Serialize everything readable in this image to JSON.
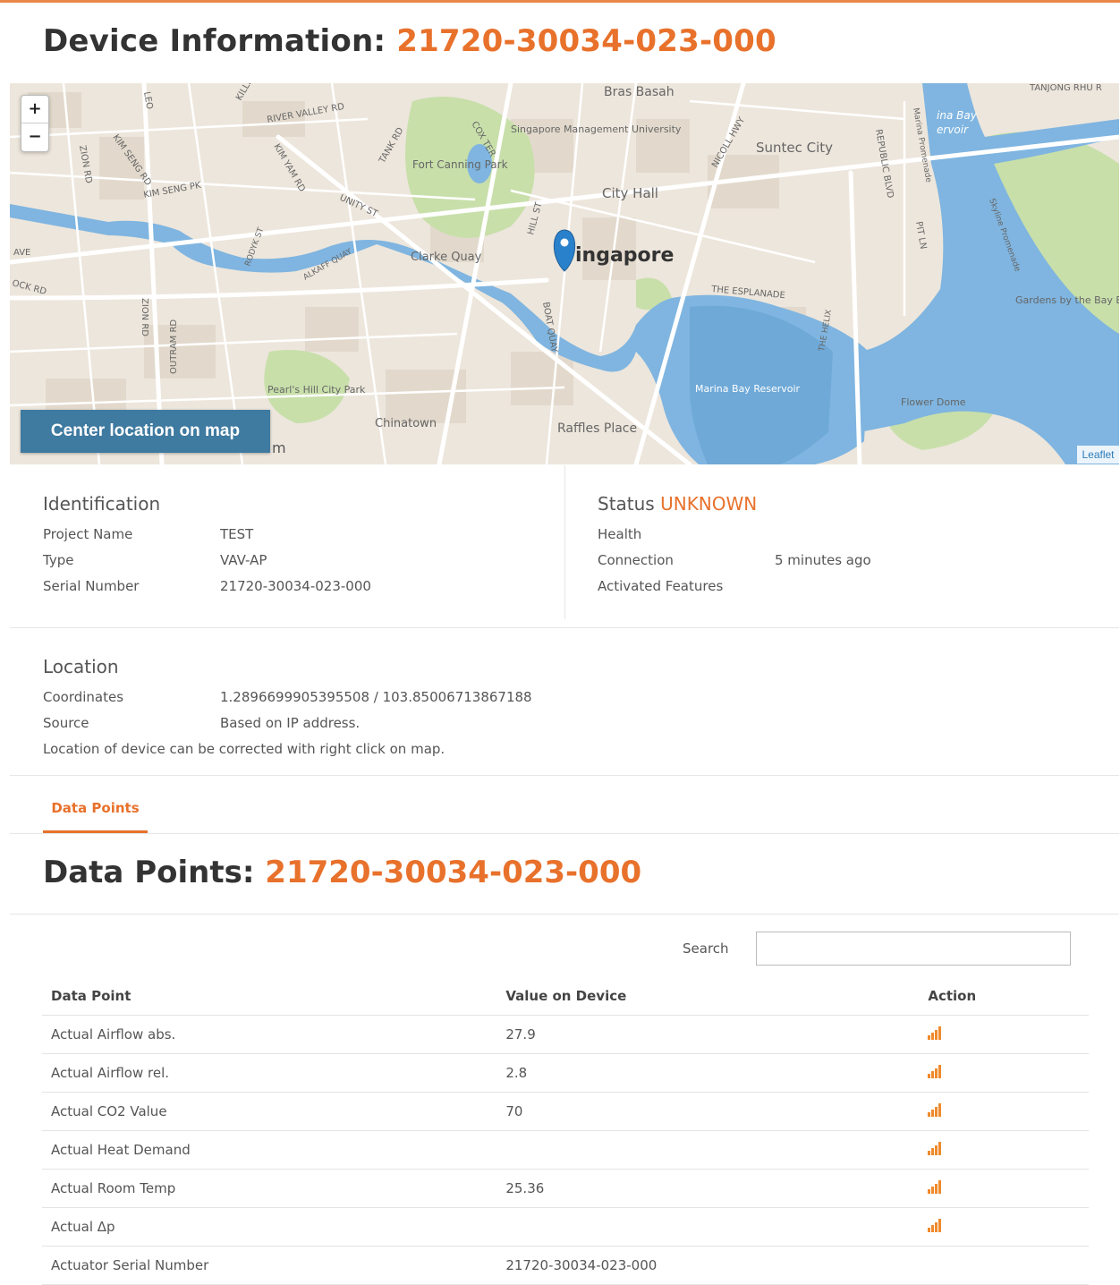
{
  "page": {
    "title_prefix": "Device Information:",
    "device_id": "21720-30034-023-000"
  },
  "map": {
    "zoom_in": "+",
    "zoom_out": "−",
    "center_button": "Center location on map",
    "attribution": "Leaflet",
    "labels": {
      "bras_basah": "Bras Basah",
      "tanjong": "TANJONG RHU R",
      "river_valley": "RIVER VALLEY RD",
      "kim_seng_rd": "KIM SENG RD",
      "kim_seng_pk": "KIM SENG PK",
      "zion_rd": "ZION RD",
      "zion_rd2": "ZION RD",
      "outram": "OUTRAM RD",
      "smu": "Singapore Management University",
      "fort_canning": "Fort Canning Park",
      "suntec": "Suntec City",
      "city_hall": "City Hall",
      "singapore": "ingapore",
      "clarke_quay": "Clarke Quay",
      "esplanade": "THE ESPLANADE",
      "marina_bay": "Marina Bay Reservoir",
      "gardens": "Gardens by the Bay East",
      "flower_dome": "Flower Dome",
      "raffles": "Raffles Place",
      "chinatown": "Chinatown",
      "pearls_hill": "Pearl's Hill City Park",
      "republic": "REPUBLIC BLVD",
      "nicoll": "NICOLL HWY",
      "marina_promenade": "Marina Promenade",
      "pit_ln": "PIT LN",
      "hill_st": "HILL ST",
      "boat_quay": "BOAT QUAY",
      "tank_rd": "TANK RD",
      "unity_st": "UNITY ST",
      "alkaff": "ALKAFF QUAY",
      "kim_yam": "KIM YAM RD",
      "rodyk": "RODYK ST",
      "ave": "AVE",
      "ock_rd": "OCK RD",
      "the_helix": "THE HELIX",
      "skyline": "Skyline Promenade",
      "rina_bay": "ina Bay",
      "ervoir": "ervoir",
      "leo": "LEO",
      "killiney": "KILLI",
      "m_frag": "m",
      "cox_ter": "COX TER"
    }
  },
  "identification": {
    "heading": "Identification",
    "rows": [
      {
        "label": "Project Name",
        "value": "TEST"
      },
      {
        "label": "Type",
        "value": "VAV-AP"
      },
      {
        "label": "Serial Number",
        "value": "21720-30034-023-000"
      }
    ]
  },
  "status": {
    "heading": "Status",
    "state": "UNKNOWN",
    "rows": [
      {
        "label": "Health",
        "value": ""
      },
      {
        "label": "Connection",
        "value": "5 minutes ago"
      },
      {
        "label": "Activated Features",
        "value": ""
      }
    ]
  },
  "location": {
    "heading": "Location",
    "rows": [
      {
        "label": "Coordinates",
        "value": "1.2896699905395508 / 103.85006713867188"
      },
      {
        "label": "Source",
        "value": "Based on IP address."
      }
    ],
    "note": "Location of device can be corrected with right click on map."
  },
  "tabs": [
    {
      "label": "Data Points",
      "active": true
    }
  ],
  "data_points": {
    "title_prefix": "Data Points:",
    "device_id": "21720-30034-023-000",
    "search_label": "Search",
    "search_value": "",
    "columns": [
      "Data Point",
      "Value on Device",
      "Action"
    ],
    "rows": [
      {
        "name": "Actual Airflow abs.",
        "value": "27.9",
        "action": "chart-icon"
      },
      {
        "name": "Actual Airflow rel.",
        "value": "2.8",
        "action": "chart-icon"
      },
      {
        "name": "Actual CO2 Value",
        "value": "70",
        "action": "chart-icon"
      },
      {
        "name": "Actual Heat Demand",
        "value": "",
        "action": "chart-icon"
      },
      {
        "name": "Actual Room Temp",
        "value": "25.36",
        "action": "chart-icon"
      },
      {
        "name": "Actual Δp",
        "value": "",
        "action": "chart-icon"
      },
      {
        "name": "Actuator Serial Number",
        "value": "21720-30034-023-000",
        "action": ""
      }
    ]
  },
  "colors": {
    "accent": "#e8712b",
    "button": "#3f7aa0",
    "water": "#7fb5e0",
    "park": "#c5dfa8"
  }
}
